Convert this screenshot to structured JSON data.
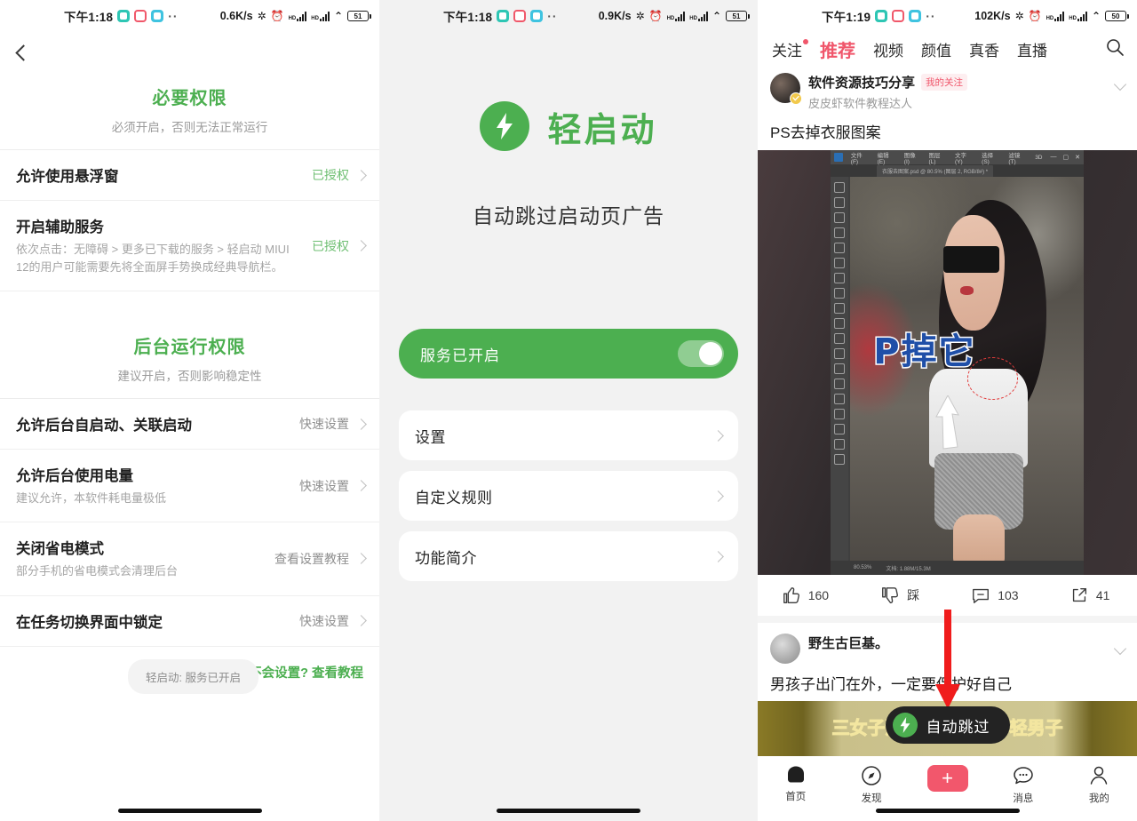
{
  "panel1": {
    "statusbar": {
      "time": "下午1:18",
      "app_icons": [
        "teal-app-icon",
        "red-app-icon",
        "blue-app-icon"
      ],
      "more_dots": "··",
      "network_speed": "0.6K/s",
      "bluetooth_icon": "bluetooth-icon",
      "alarm_icon": "alarm-icon",
      "hd_label": "HD",
      "wifi_icon": "wifi-icon",
      "battery": "51"
    },
    "back_icon": "back-chevron-icon",
    "sections": [
      {
        "title": "必要权限",
        "subtitle": "必须开启，否则无法正常运行",
        "rows": [
          {
            "title": "允许使用悬浮窗",
            "desc": "",
            "value": "已授权",
            "granted": true
          },
          {
            "title": "开启辅助服务",
            "desc": "依次点击：无障碍 > 更多已下载的服务 > 轻启动 MIUI 12的用户可能需要先将全面屏手势换成经典导航栏。",
            "value": "已授权",
            "granted": true
          }
        ]
      },
      {
        "title": "后台运行权限",
        "subtitle": "建议开启，否则影响稳定性",
        "rows": [
          {
            "title": "允许后台自启动、关联启动",
            "desc": "",
            "value": "快速设置",
            "granted": false
          },
          {
            "title": "允许后台使用电量",
            "desc": "建议允许，本软件耗电量极低",
            "value": "快速设置",
            "granted": false
          },
          {
            "title": "关闭省电模式",
            "desc": "部分手机的省电模式会清理后台",
            "value": "查看设置教程",
            "granted": false
          },
          {
            "title": "在任务切换界面中锁定",
            "desc": "",
            "value": "快速设置",
            "granted": false
          }
        ]
      }
    ],
    "help_link": "不会设置? 查看教程",
    "toast": "轻启动: 服务已开启"
  },
  "panel2": {
    "statusbar": {
      "time": "下午1:18",
      "more_dots": "··",
      "network_speed": "0.9K/s",
      "hd_label": "HD",
      "battery": "51"
    },
    "brand_name": "轻启动",
    "brand_logo_icon": "lightning-bolt-icon",
    "tagline": "自动跳过启动页广告",
    "service_card": {
      "label": "服务已开启",
      "toggle_on": true
    },
    "menu_items": [
      {
        "label": "设置"
      },
      {
        "label": "自定义规则"
      },
      {
        "label": "功能简介"
      }
    ]
  },
  "panel3": {
    "statusbar": {
      "time": "下午1:19",
      "more_dots": "··",
      "network_speed": "102K/s",
      "hd_label": "HD",
      "battery": "50"
    },
    "tabs": [
      {
        "label": "关注",
        "active": false,
        "dot": true
      },
      {
        "label": "推荐",
        "active": true,
        "dot": false
      },
      {
        "label": "视频",
        "active": false,
        "dot": false
      },
      {
        "label": "颜值",
        "active": false,
        "dot": false
      },
      {
        "label": "真香",
        "active": false,
        "dot": false
      },
      {
        "label": "直播",
        "active": false,
        "dot": false
      }
    ],
    "search_icon": "search-icon",
    "post1": {
      "author": "软件资源技巧分享",
      "tag": "我的关注",
      "subtitle": "皮皮虾软件教程达人",
      "title": "PS去掉衣服图案",
      "more_icon": "chevron-down-icon",
      "verified_badge_icon": "verified-badge-icon",
      "photoshop": {
        "menus": [
          "文件(F)",
          "编辑(E)",
          "图像(I)",
          "图层(L)",
          "文字(Y)",
          "选择(S)",
          "滤镜(T)",
          "3D"
        ],
        "window_buttons": [
          "minimize",
          "maximize",
          "close"
        ],
        "document_tab": "衣服去图案.psd @ 80.5% (图层 2, RGB/8#) *",
        "overlay_text": "P掉它",
        "zoom_level": "80.53%",
        "status_text": "文档: 1.88M/15.3M"
      },
      "actions": [
        {
          "icon": "thumbs-up-icon",
          "label": "160"
        },
        {
          "icon": "thumbs-down-icon",
          "label": "踩"
        },
        {
          "icon": "comment-icon",
          "label": "103"
        },
        {
          "icon": "share-icon",
          "label": "41"
        }
      ]
    },
    "post2": {
      "author": "野生古巨基。",
      "title": "男孩子出门在外，一定要保护好自己",
      "more_icon": "chevron-down-icon",
      "media_caption": "三女子酒后合伙侵犯年轻男子"
    },
    "skip_pill": {
      "label": "自动跳过",
      "icon": "lightning-bolt-icon"
    },
    "red_arrow_icon": "red-down-arrow-icon",
    "tabbar": [
      {
        "icon": "home-icon",
        "label": "首页"
      },
      {
        "icon": "compass-icon",
        "label": "发现"
      },
      {
        "icon": "plus-icon",
        "label": ""
      },
      {
        "icon": "message-icon",
        "label": "消息"
      },
      {
        "icon": "profile-icon",
        "label": "我的"
      }
    ]
  },
  "colors": {
    "green": "#4CAF50",
    "pink": "#F0566B",
    "grey_text": "#9a9a9a"
  }
}
